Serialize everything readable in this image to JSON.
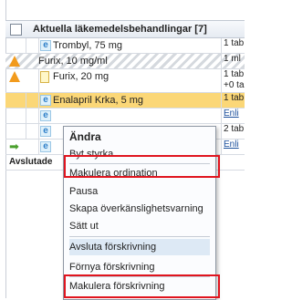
{
  "header": {
    "title": "Aktuella läkemedelsbehandlingar [7]"
  },
  "rows": [
    {
      "name": "Trombyl, 75 mg",
      "right": "1 tab"
    },
    {
      "name": "Furix, 10 mg/ml",
      "right": "1 ml"
    },
    {
      "name": "Furix, 20 mg",
      "right": "1 tab\n+0 ta"
    },
    {
      "name": "Enalapril Krka, 5 mg",
      "right": "1 tab"
    },
    {
      "name": "",
      "right": "Enli"
    },
    {
      "name": "",
      "right": "2 tab"
    },
    {
      "name": "",
      "right": "Enli"
    }
  ],
  "footer": {
    "label": "Avslutade"
  },
  "menu": {
    "items": [
      "Ändra",
      "Byt styrka",
      "Makulera ordination",
      "Pausa",
      "Skapa överkänslighetsvarning",
      "Sätt ut",
      "Avsluta förskrivning",
      "Förnya förskrivning",
      "Makulera förskrivning"
    ]
  },
  "colors": {
    "selected_row": "#fbd777",
    "highlight_border": "#e0141e",
    "warning": "#f29b1d",
    "link": "#1b4f9c"
  }
}
